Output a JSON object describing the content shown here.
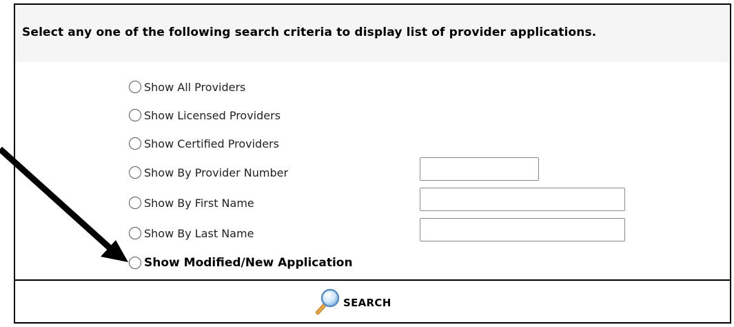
{
  "header": {
    "instruction": "Select any one of the following search criteria to display list of provider applications."
  },
  "options": [
    {
      "label": "Show All Providers",
      "bold": false
    },
    {
      "label": "Show Licensed Providers",
      "bold": false
    },
    {
      "label": "Show Certified Providers",
      "bold": false
    },
    {
      "label": "Show By Provider Number",
      "bold": false
    },
    {
      "label": "Show By First Name",
      "bold": false
    },
    {
      "label": "Show By Last Name",
      "bold": false
    },
    {
      "label": "Show Modified/New Application",
      "bold": true
    }
  ],
  "fields": {
    "provider_number": {
      "value": "",
      "placeholder": ""
    },
    "first_name": {
      "value": "",
      "placeholder": ""
    },
    "last_name": {
      "value": "",
      "placeholder": ""
    }
  },
  "search": {
    "label": "SEARCH",
    "icon": "magnifier-icon"
  },
  "annotation": {
    "icon": "pointer-arrow"
  }
}
